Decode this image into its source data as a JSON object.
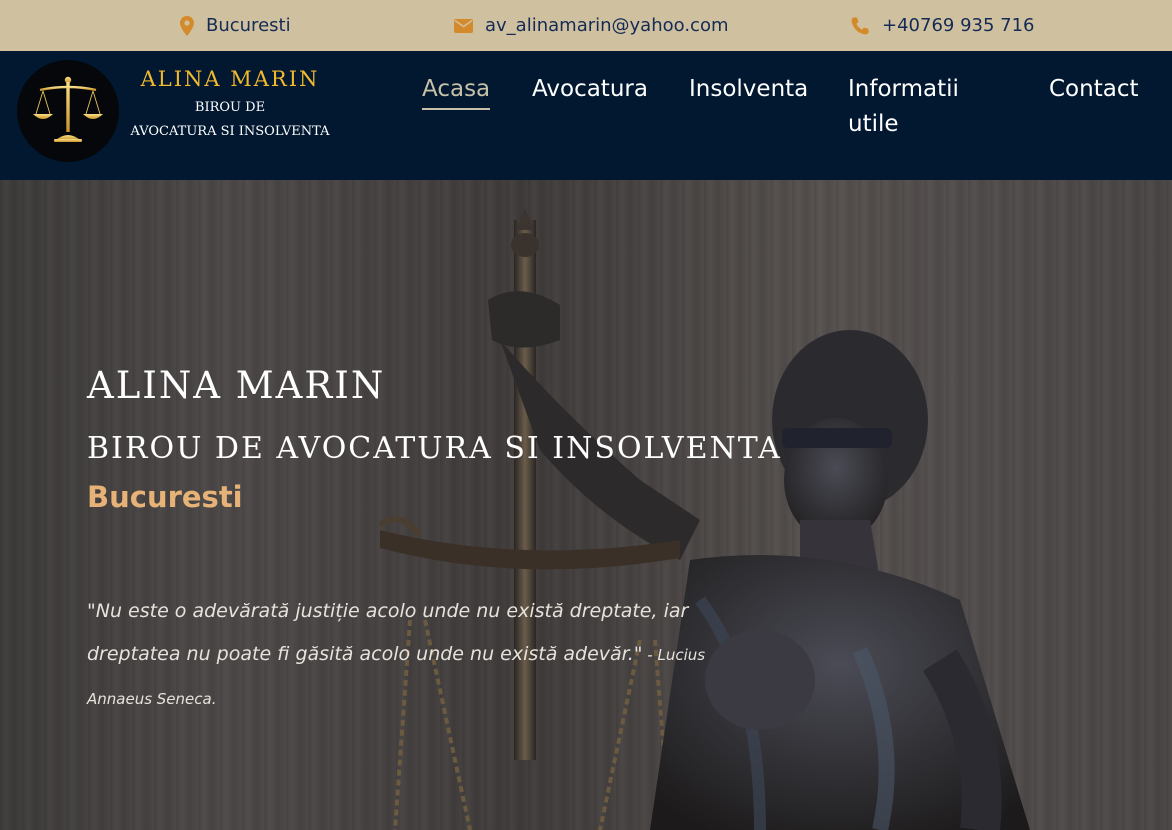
{
  "topbar": {
    "location": "Bucuresti",
    "email": "av_alinamarin@yahoo.com",
    "phone": "+40769 935 716",
    "icons": {
      "location": "map-marker-icon",
      "email": "envelope-icon",
      "phone": "phone-icon"
    },
    "icon_color": "#d48a2a",
    "text_color": "#152a55",
    "background": "#cfc19f"
  },
  "header": {
    "background": "#011830",
    "logo_icon": "scales-of-justice-icon",
    "brand_name": "ALINA MARIN",
    "brand_line1": "BIROU DE",
    "brand_line2": "AVOCATURA SI INSOLVENTA",
    "brand_color": "#f2b92f"
  },
  "nav": {
    "items": [
      {
        "label": "Acasa",
        "active": true
      },
      {
        "label": "Avocatura"
      },
      {
        "label": "Insolventa"
      },
      {
        "label": "Informatii utile"
      },
      {
        "label": "Contact"
      }
    ]
  },
  "hero": {
    "title": "ALINA MARIN",
    "subtitle": "BIROU DE AVOCATURA SI INSOLVENTA",
    "city": "Bucuresti",
    "city_color": "#e6b277",
    "quote": "\"Nu este o adevărată justiție acolo unde nu există dreptate, iar dreptatea nu poate fi găsită acolo unde nu există adevăr.\"",
    "quote_author": " - Lucius Annaeus Seneca."
  }
}
